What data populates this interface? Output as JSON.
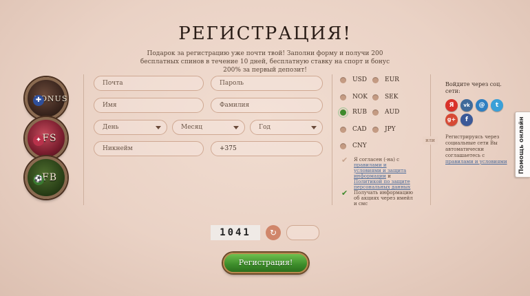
{
  "title": "РЕГИСТРАЦИЯ!",
  "subtitle": "Подарок за регистрацию уже почти твой! Заполни форму и получи 200 бесплатных спинов в течение 10 дней, бесплатную ставку на спорт и бонус 200% за первый депозит!",
  "badges": [
    {
      "label": "BONUS",
      "icon": "shield-icon"
    },
    {
      "label": "FS",
      "icon": "compass-icon"
    },
    {
      "label": "FB",
      "icon": "football-icon"
    }
  ],
  "form": {
    "email_placeholder": "Почта",
    "password_placeholder": "Пароль",
    "name_placeholder": "Имя",
    "surname_placeholder": "Фамилия",
    "day_label": "День",
    "month_label": "Месяц",
    "year_label": "Год",
    "nickname_placeholder": "Никнейм",
    "phone_value": "+375"
  },
  "currencies": [
    {
      "code": "USD",
      "selected": false
    },
    {
      "code": "EUR",
      "selected": false
    },
    {
      "code": "NOK",
      "selected": false
    },
    {
      "code": "SEK",
      "selected": false
    },
    {
      "code": "RUB",
      "selected": true
    },
    {
      "code": "AUD",
      "selected": false
    },
    {
      "code": "CAD",
      "selected": false
    },
    {
      "code": "JPY",
      "selected": false
    },
    {
      "code": "CNY",
      "selected": false
    }
  ],
  "agree": {
    "prefix": "Я согласен (-на) с ",
    "link1": "правилами и условиями и защита информации",
    "middle": " и ",
    "link2": "Политикой по защите персональных данных"
  },
  "promo": "Получать информацию об акциях через имейл и смс",
  "divider": "или",
  "social": {
    "title": "Войдите через соц. сети:",
    "networks": [
      {
        "name": "yandex",
        "glyph": "Я",
        "color": "#d9322a"
      },
      {
        "name": "vk",
        "glyph": "vk",
        "color": "#3f6a9a"
      },
      {
        "name": "mailru",
        "glyph": "@",
        "color": "#2f7fc1"
      },
      {
        "name": "twitter",
        "glyph": "t",
        "color": "#3aa0d8"
      },
      {
        "name": "google-plus",
        "glyph": "g+",
        "color": "#d64a35"
      },
      {
        "name": "facebook",
        "glyph": "f",
        "color": "#3b5998"
      }
    ],
    "note_prefix": "Регистрируясь через социальные сети Вы автоматически соглашаетесь с ",
    "note_link": "правилами и условиями"
  },
  "help": "Помощь онлайн",
  "captcha_text": "1041",
  "submit": "Регистрация!"
}
